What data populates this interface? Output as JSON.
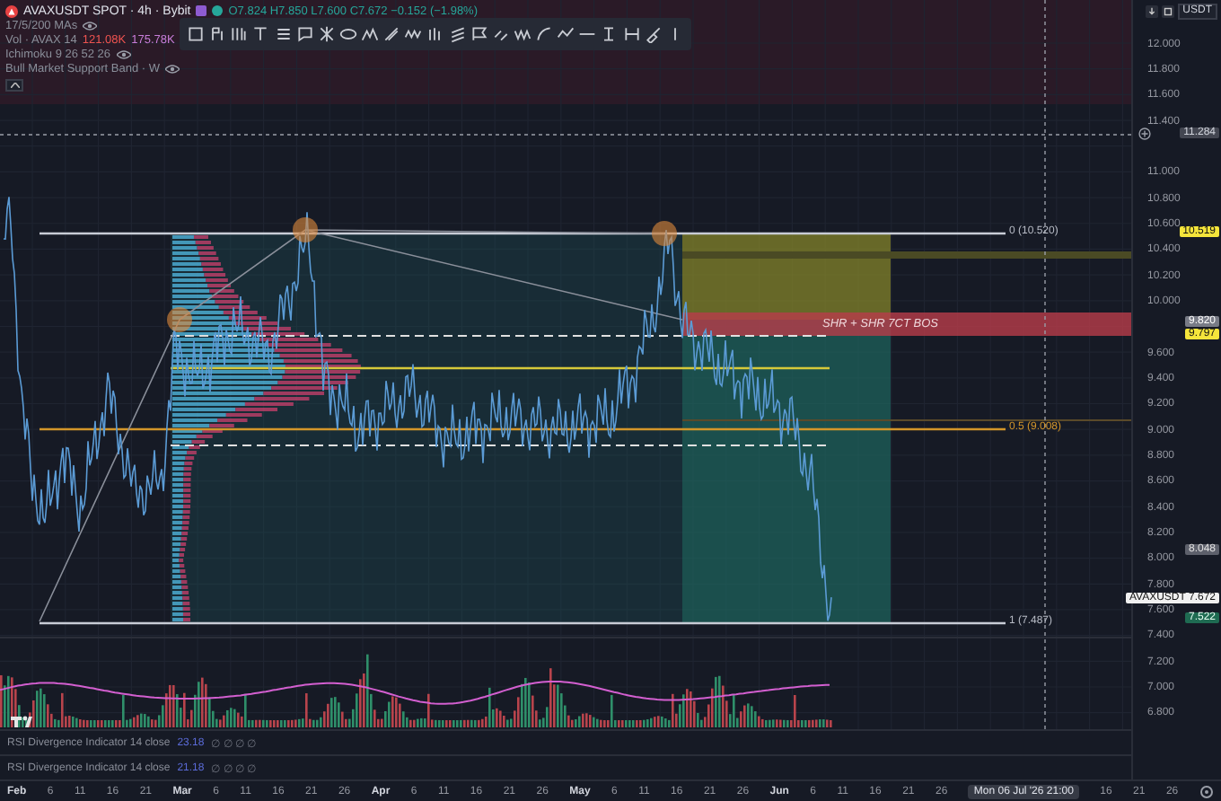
{
  "header": {
    "symbol": "AVAXUSDT SPOT · 4h · Bybit",
    "ohlc": "O7.824 H7.850 L7.600 C7.672 −0.152 (−1.98%)",
    "indicators": [
      {
        "label": "17/5/200 MAs"
      },
      {
        "label": "Vol · AVAX 14",
        "values": [
          "121.08K",
          "175.78K"
        ]
      },
      {
        "label": "Ichimoku 9 26 52 26"
      },
      {
        "label": "Bull Market Support Band · W"
      }
    ]
  },
  "currency": "USDT",
  "price_ticks": [
    "12.000",
    "11.800",
    "11.600",
    "11.400",
    "11.000",
    "10.800",
    "10.600",
    "10.400",
    "10.200",
    "10.000",
    "9.600",
    "9.400",
    "9.200",
    "9.000",
    "8.800",
    "8.600",
    "8.400",
    "8.200",
    "8.000",
    "7.800",
    "7.600",
    "7.400",
    "7.200",
    "7.000",
    "6.800"
  ],
  "price_badges": [
    {
      "kind": "crosshair",
      "value": "11.284"
    },
    {
      "kind": "fib",
      "value": "10.519"
    },
    {
      "kind": "zone",
      "value": "9.820"
    },
    {
      "kind": "fib",
      "value": "9.797"
    },
    {
      "kind": "level",
      "value": "8.048"
    },
    {
      "kind": "last",
      "label": "AVAXUSDT",
      "value": "7.672"
    },
    {
      "kind": "close",
      "value": "7.522"
    }
  ],
  "fib_levels": [
    {
      "kind": "edge",
      "label": "0 (10.520)"
    },
    {
      "kind": "mid",
      "label": "0.5 (9.008)"
    },
    {
      "kind": "edge",
      "label": "1 (7.487)"
    }
  ],
  "zone_label": "SHR + SHR 7CT BOS",
  "rsi_panes": [
    {
      "label": "RSI Divergence Indicator 14 close",
      "value": "23.18",
      "marks": "∅ ∅ ∅ ∅"
    },
    {
      "label": "RSI Divergence Indicator 14 close",
      "value": "21.18",
      "marks": "∅ ∅ ∅ ∅"
    }
  ],
  "time_axis": [
    {
      "kind": "month",
      "text": "Feb"
    },
    {
      "kind": "day",
      "text": "6"
    },
    {
      "kind": "day",
      "text": "11"
    },
    {
      "kind": "day",
      "text": "16"
    },
    {
      "kind": "day",
      "text": "21"
    },
    {
      "kind": "month",
      "text": "Mar"
    },
    {
      "kind": "day",
      "text": "6"
    },
    {
      "kind": "day",
      "text": "11"
    },
    {
      "kind": "day",
      "text": "16"
    },
    {
      "kind": "day",
      "text": "21"
    },
    {
      "kind": "day",
      "text": "26"
    },
    {
      "kind": "month",
      "text": "Apr"
    },
    {
      "kind": "day",
      "text": "6"
    },
    {
      "kind": "day",
      "text": "11"
    },
    {
      "kind": "day",
      "text": "16"
    },
    {
      "kind": "day",
      "text": "21"
    },
    {
      "kind": "day",
      "text": "26"
    },
    {
      "kind": "month",
      "text": "May"
    },
    {
      "kind": "day",
      "text": "6"
    },
    {
      "kind": "day",
      "text": "11"
    },
    {
      "kind": "day",
      "text": "16"
    },
    {
      "kind": "day",
      "text": "21"
    },
    {
      "kind": "day",
      "text": "26"
    },
    {
      "kind": "month",
      "text": "Jun"
    },
    {
      "kind": "day",
      "text": "6"
    },
    {
      "kind": "day",
      "text": "11"
    },
    {
      "kind": "day",
      "text": "16"
    },
    {
      "kind": "day",
      "text": "21"
    },
    {
      "kind": "day",
      "text": "26"
    },
    {
      "kind": "cursor",
      "text": "Mon 06 Jul '26  21:00"
    },
    {
      "kind": "day",
      "text": "16"
    },
    {
      "kind": "day",
      "text": "21"
    },
    {
      "kind": "day",
      "text": "26"
    }
  ]
}
